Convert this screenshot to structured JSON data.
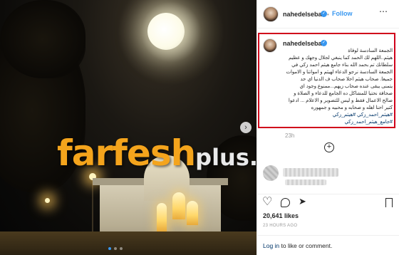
{
  "post": {
    "username": "nahedelsebai",
    "separator": "•",
    "follow_label": "Follow",
    "caption_lines": [
      "الجمعة السادسة لوفاة",
      "هيثم..اللهم لك الحمد كما ينبغي لجلال وجهك و عظيم",
      "سلطانك تم بحمد الله بناء جامع هيثم احمد زكي في",
      "الجمعة السادسة نرجو الدعاء لهيثم و امواتنا و الاموات",
      "جميعا. صحاب هيثم احلا صحاب ف الدنيا اي حد",
      "يتمنى يبقى عنده صحاب زيهم...ممنوع وجود اي",
      "صحافة نحتيا للمشاكل ده الجامع للدعاء و الصلاة و",
      "صالح الاعمال فقط و ليس للتصوير و الاعلام ... ادعوا",
      "كتير احنا اهله و صحابه و محبيه و جمهوره"
    ],
    "hashtags": [
      "#هيثم_احمد_زكي",
      "#هيثم_زكي",
      "#جامع_هيثم_احمد_زكي"
    ],
    "comment_time": "23h",
    "likes": "20,641 likes",
    "time_ago": "23 HOURS AGO"
  },
  "watermark": {
    "main": "farfesh",
    "suffix": "plus.com"
  },
  "login_bar": {
    "login": "Log in",
    "rest": " to like or comment."
  },
  "icons": {
    "verified": "verified-badge-icon",
    "more": "more-options-icon",
    "add": "add-icon",
    "like": "heart-icon",
    "comment": "comment-icon",
    "share": "share-icon",
    "save": "bookmark-icon",
    "next": "chevron-right-icon"
  },
  "colors": {
    "accent": "#3897f0",
    "highlight_box": "#d0021b",
    "hashtag": "#003569",
    "watermark_orange": "#f4a41c"
  },
  "carousel": {
    "total": 3,
    "active_index": 0
  }
}
